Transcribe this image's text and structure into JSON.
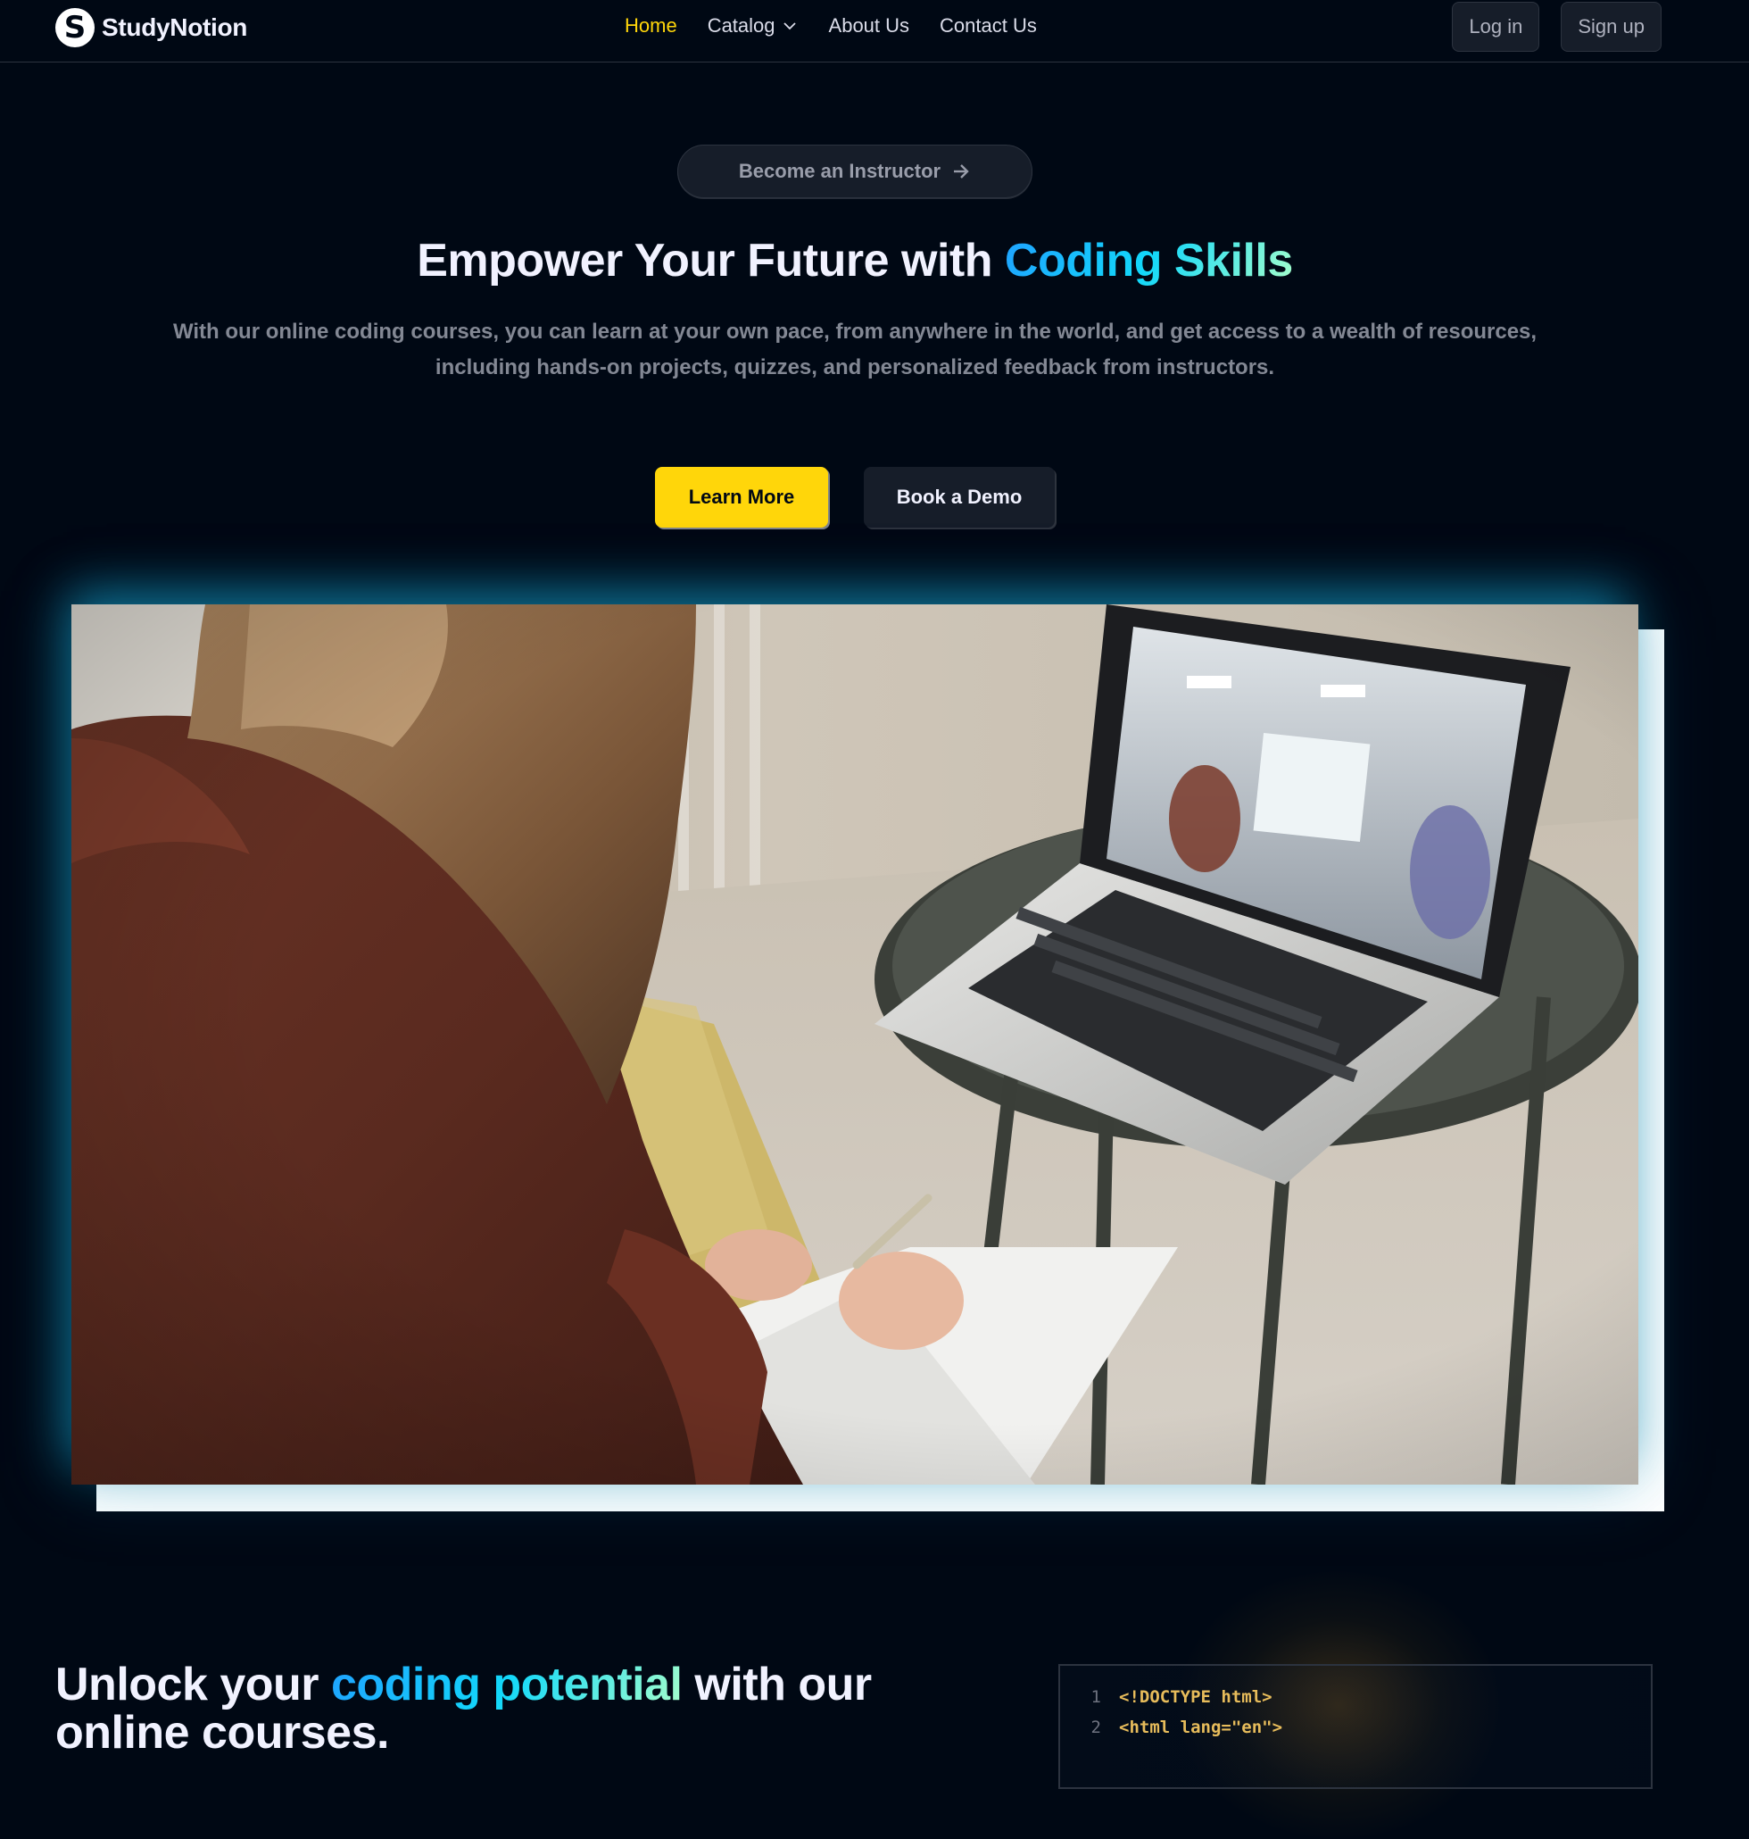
{
  "brand": {
    "name": "StudyNotion",
    "logo_letter": "S"
  },
  "nav": {
    "links": [
      "Home",
      "Catalog",
      "About Us",
      "Contact Us"
    ],
    "active": "Home"
  },
  "auth": {
    "login": "Log in",
    "signup": "Sign up"
  },
  "hero": {
    "instructor_cta": "Become an Instructor",
    "title_prefix": "Empower Your Future with ",
    "title_highlight": "Coding Skills",
    "subtitle": "With our online coding courses, you can learn at your own pace, from anywhere in the world, and get access to a wealth of resources, including hands-on projects, quizzes, and personalized feedback from instructors.",
    "primary_cta": "Learn More",
    "secondary_cta": "Book a Demo"
  },
  "section2": {
    "title_prefix": "Unlock your ",
    "title_highlight": "coding potential",
    "title_suffix": " with our online courses.",
    "code_lines": [
      {
        "num": "1",
        "text": "<!DOCTYPE html>"
      },
      {
        "num": "2",
        "text": "<html lang=\"en\">"
      }
    ]
  },
  "colors": {
    "background": "#000814",
    "accent_yellow": "#FFD60A",
    "gradient": [
      "#1FA2FF",
      "#12D8FA",
      "#A6FFCB"
    ],
    "code_text": "#E7BC5B"
  },
  "icons": [
    "logo-icon",
    "chevron-down-icon",
    "arrow-right-icon"
  ]
}
